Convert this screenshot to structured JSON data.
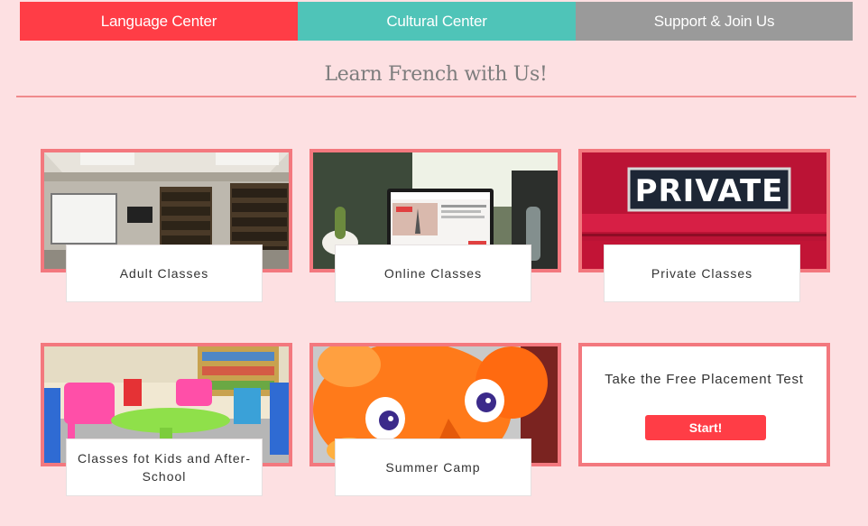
{
  "nav": {
    "language_center": "Language Center",
    "cultural_center": "Cultural Center",
    "support": "Support & Join Us"
  },
  "headline": "Learn French with Us!",
  "cards": {
    "adult": "Adult Classes",
    "online": "Online Classes",
    "private": "Private Classes",
    "kids": "Classes fot Kids and After-School",
    "summer": "Summer Camp"
  },
  "private_sign": "PRIVATE",
  "placement": {
    "text": "Take the Free Placement Test",
    "button": "Start!"
  },
  "colors": {
    "background": "#fde0e2",
    "language_center": "#ff3d46",
    "cultural_center": "#4fc4b8",
    "support": "#9a9a9a",
    "card_border": "#f3787e"
  }
}
